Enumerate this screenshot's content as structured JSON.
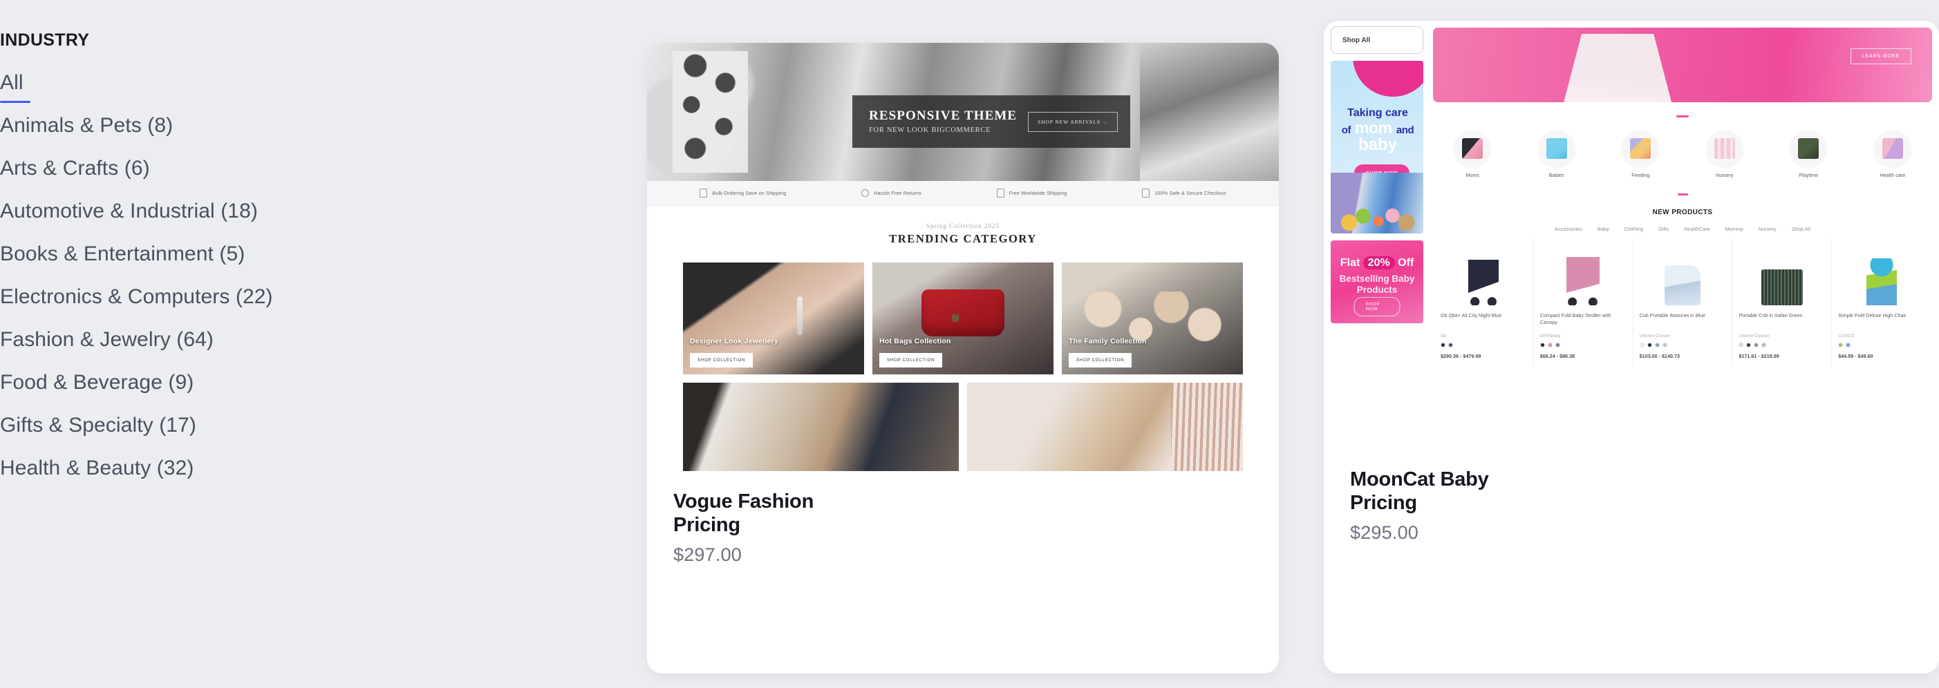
{
  "sidebar": {
    "title": "INDUSTRY",
    "items": [
      {
        "label": "All",
        "active": true
      },
      {
        "label": "Animals & Pets (8)",
        "active": false
      },
      {
        "label": "Arts & Crafts (6)",
        "active": false
      },
      {
        "label": "Automotive & Industrial (18)",
        "active": false
      },
      {
        "label": "Books & Entertainment (5)",
        "active": false
      },
      {
        "label": "Electronics & Computers (22)",
        "active": false
      },
      {
        "label": "Fashion & Jewelry (64)",
        "active": false
      },
      {
        "label": "Food & Beverage (9)",
        "active": false
      },
      {
        "label": "Gifts & Specialty (17)",
        "active": false
      },
      {
        "label": "Health & Beauty (32)",
        "active": false
      }
    ],
    "active_underline_color": "#3b5bfd"
  },
  "cards": [
    {
      "name": "vogue-fashion",
      "title": "Vogue Fashion Pricing",
      "price": "$297.00",
      "preview": {
        "hero": {
          "headline": "RESPONSIVE THEME",
          "subline": "FOR NEW LOOK BIGCOMMERCE",
          "button": "SHOP NEW ARRIVALS →"
        },
        "features": [
          "Bulk Ordering Save on Shipping",
          "Hassle Free Returns",
          "Free Worldwide Shipping",
          "100% Safe & Secure Checkout"
        ],
        "section_eyebrow": "Spring Collection 2025",
        "section_heading": "TRENDING CATEGORY",
        "tiles": [
          {
            "label": "Designer Look Jewellery",
            "button": "SHOP COLLECTION"
          },
          {
            "label": "Hot Bags Collection",
            "button": "SHOP COLLECTION"
          },
          {
            "label": "The Family Collection",
            "button": "SHOP COLLECTION"
          }
        ]
      }
    },
    {
      "name": "mooncat-baby",
      "title": "MoonCat Baby Pricing",
      "price": "$295.00",
      "preview": {
        "tab": "Shop All",
        "promo": {
          "line1": "Taking care",
          "line2_pre": "of",
          "line2_main": "mom",
          "line2_post": "and",
          "line3": "baby",
          "button": "SHOP NOW"
        },
        "sale": {
          "prefix": "Flat",
          "badge": "20%",
          "suffix": "Off",
          "line2": "Bestselling Baby",
          "line3": "Products",
          "button": "SHOP NOW"
        },
        "hero_button": "LEARN MORE",
        "categories": [
          {
            "label": "Moms"
          },
          {
            "label": "Babies"
          },
          {
            "label": "Feeding"
          },
          {
            "label": "Nursery"
          },
          {
            "label": "Playtime"
          },
          {
            "label": "Health care"
          }
        ],
        "products_heading": "NEW PRODUCTS",
        "product_tabs": [
          "Accessories",
          "Baby",
          "Clothing",
          "Gifts",
          "HealthCare",
          "Mommy",
          "Nursery",
          "Shop All"
        ],
        "products": [
          {
            "name": "Gb Qbit+ All City Night Blue",
            "brand": "Gb",
            "price": "$290.36 - $479.99",
            "swatches": [
              "#2a2a33",
              "#3d4f7a"
            ]
          },
          {
            "name": "Compact Fold Baby Stroller with Canopy",
            "brand": "UPPAbaby",
            "price": "$66.24 - $86.38",
            "swatches": [
              "#2a2a33",
              "#d98cae",
              "#6f7fa8"
            ]
          },
          {
            "name": "Cub Portable Bassinet in Blue",
            "brand": "Unicorn Cocoon",
            "price": "$103.00 - $140.73",
            "swatches": [
              "#e6eef6",
              "#2a2a33",
              "#7aa5c8",
              "#c9c9d2"
            ]
          },
          {
            "name": "Portable Crib in Safari Green",
            "brand": "Unicorn Cocoon",
            "price": "$171.61 - $219.99",
            "swatches": [
              "#d8d8de",
              "#2f3f33",
              "#8c9a84",
              "#b6c0ae"
            ]
          },
          {
            "name": "Simple Fold Deluxe High Chair",
            "brand": "COSCO",
            "price": "$44.99 - $49.60",
            "swatches": [
              "#9fd13c",
              "#5aa7d8"
            ]
          }
        ]
      }
    }
  ]
}
